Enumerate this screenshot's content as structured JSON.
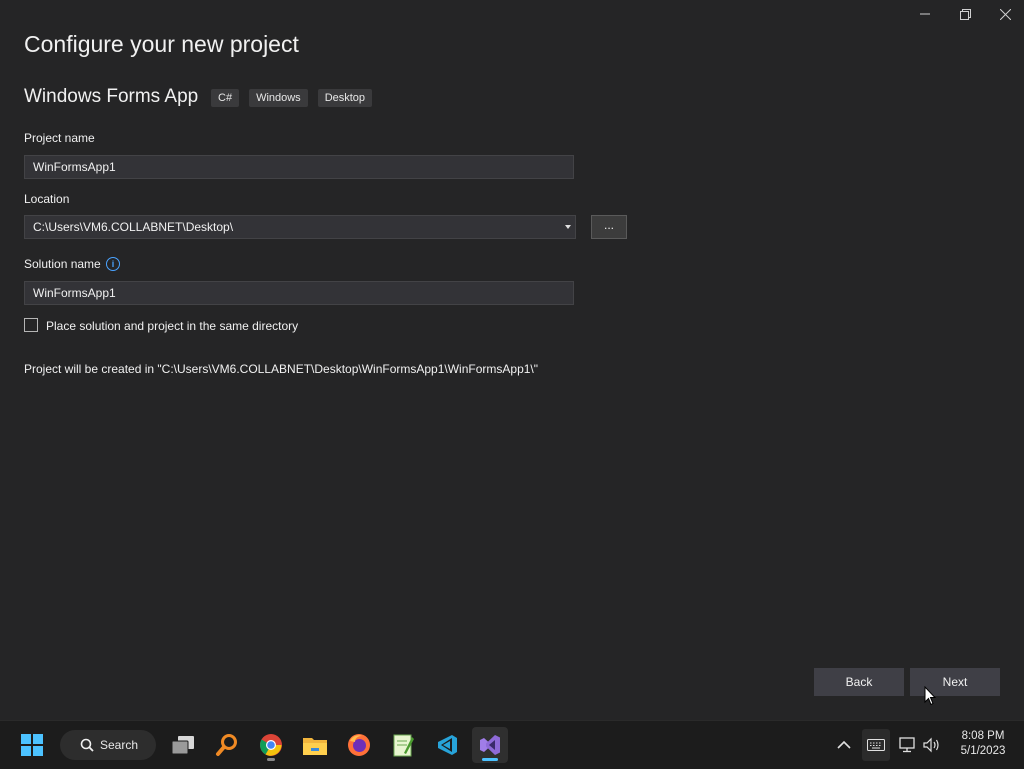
{
  "window": {
    "title": "Configure your new project"
  },
  "template": {
    "name": "Windows Forms App",
    "tags": [
      "C#",
      "Windows",
      "Desktop"
    ]
  },
  "form": {
    "project_name_label": "Project name",
    "project_name_value": "WinFormsApp1",
    "location_label": "Location",
    "location_value": "C:\\Users\\VM6.COLLABNET\\Desktop\\",
    "browse_label": "...",
    "solution_name_label": "Solution name",
    "solution_name_value": "WinFormsApp1",
    "same_directory_label": "Place solution and project in the same directory",
    "same_directory_checked": false,
    "created_in_text": "Project will be created in \"C:\\Users\\VM6.COLLABNET\\Desktop\\WinFormsApp1\\WinFormsApp1\\\""
  },
  "footer": {
    "back_label": "Back",
    "next_label": "Next"
  },
  "taskbar": {
    "search_label": "Search",
    "apps": [
      "start-icon",
      "task-view-icon",
      "magnifier-app-icon",
      "chrome-icon",
      "file-explorer-icon",
      "firefox-icon",
      "notepad-plus-icon",
      "vscode-like-icon",
      "visual-studio-icon"
    ],
    "time": "8:08 PM",
    "date": "5/1/2023"
  },
  "colors": {
    "accent": "#4cc2ff",
    "vs_purple": "#8e6ad8",
    "background": "#252526"
  }
}
